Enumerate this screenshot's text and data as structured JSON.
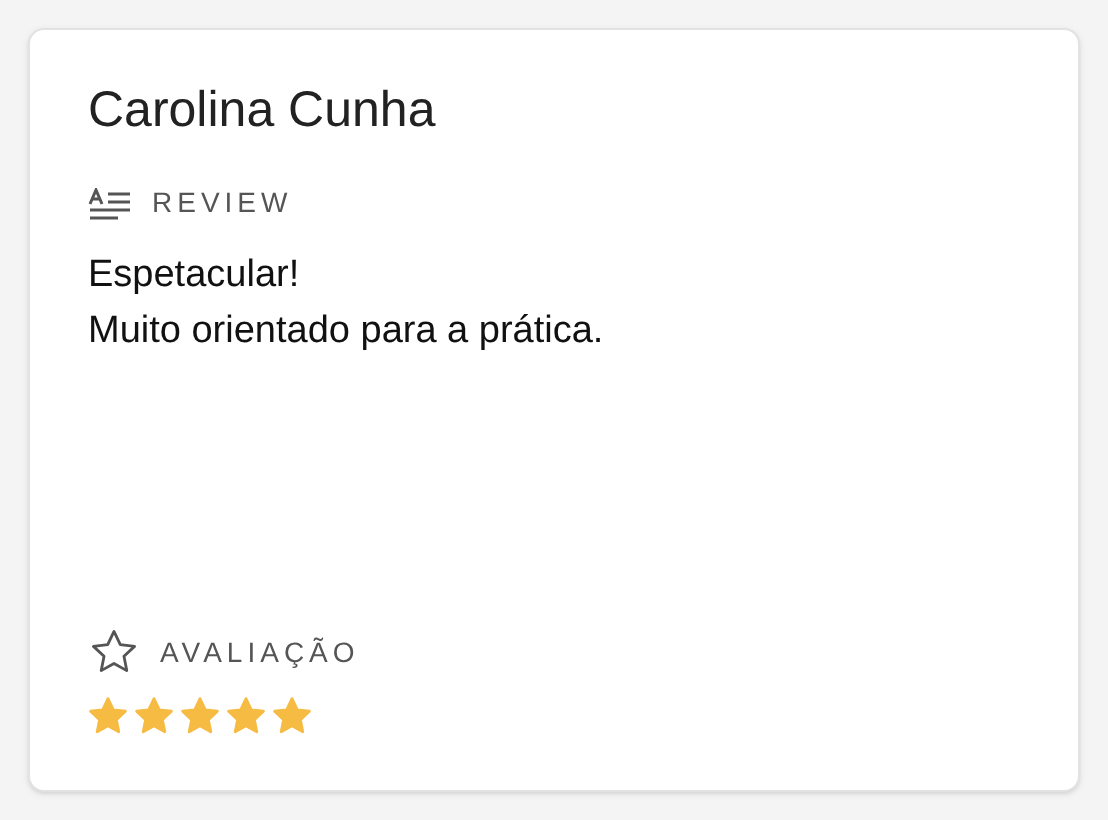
{
  "card": {
    "name": "Carolina Cunha",
    "review": {
      "label": "REVIEW",
      "lines": [
        "Espetacular!",
        "Muito orientado para a prática."
      ]
    },
    "rating": {
      "label": "AVALIAÇÃO",
      "stars": 5
    }
  }
}
